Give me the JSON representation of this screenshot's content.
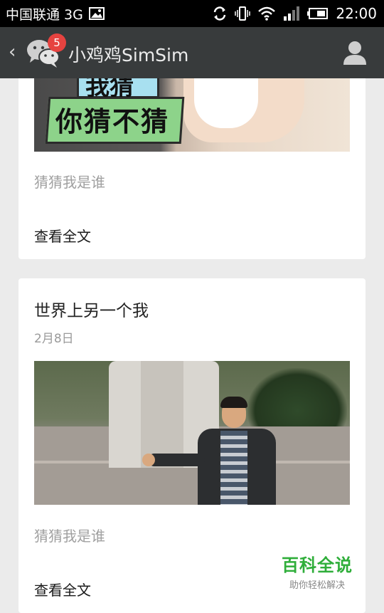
{
  "status_bar": {
    "carrier": "中国联通 3G",
    "time": "22:00"
  },
  "title_bar": {
    "back_glyph": "‹",
    "badge_count": "5",
    "title": "小鸡鸡SimSim"
  },
  "cards": [
    {
      "image_text_bottom": "你猜不猜",
      "image_text_top": "我猜",
      "summary": "猜猜我是谁",
      "read_more": "查看全文"
    },
    {
      "title": "世界上另一个我",
      "date": "2月8日",
      "summary": "猜猜我是谁",
      "read_more": "查看全文"
    }
  ],
  "watermark": {
    "main": "百科全说",
    "sub": "助你轻松解决"
  },
  "colors": {
    "title_bar_bg": "#383b3c",
    "badge": "#e64340",
    "watermark_green": "#2fae3a",
    "page_bg": "#ebebeb"
  },
  "icons": [
    "image-icon",
    "sync-icon",
    "vibrate-icon",
    "wifi-icon",
    "signal-icon",
    "battery-icon",
    "wechat-icon",
    "profile-icon"
  ]
}
